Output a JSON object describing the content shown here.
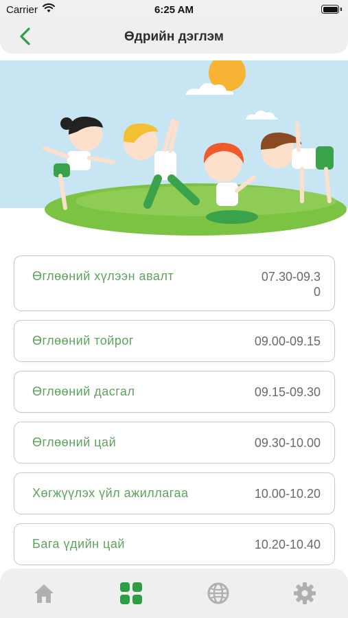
{
  "status_bar": {
    "carrier": "Carrier",
    "time": "6:25 AM"
  },
  "nav": {
    "title": "Өдрийн дэглэм",
    "back_icon": "chevron-left-icon"
  },
  "schedule": [
    {
      "name": "Өглөөний хүлээн авалт",
      "time": "07.30-09.30"
    },
    {
      "name": "Өглөөний тойрог",
      "time": "09.00-09.15"
    },
    {
      "name": "Өглөөний дасгал",
      "time": "09.15-09.30"
    },
    {
      "name": "Өглөөний цай",
      "time": "09.30-10.00"
    },
    {
      "name": "Хөгжүүлэх үйл ажиллагаа",
      "time": "10.00-10.20"
    },
    {
      "name": "Бага үдийн цай",
      "time": "10.20-10.40"
    }
  ],
  "tabs": [
    {
      "icon": "home-icon",
      "active": false
    },
    {
      "icon": "grid-icon",
      "active": true
    },
    {
      "icon": "globe-icon",
      "active": false
    },
    {
      "icon": "gear-icon",
      "active": false
    }
  ],
  "colors": {
    "accent": "#2e9e46",
    "item_name": "#5da25f",
    "inactive_icon": "#b0b0b0",
    "sky": "#c8e5f3",
    "grass": "#7cc243"
  }
}
